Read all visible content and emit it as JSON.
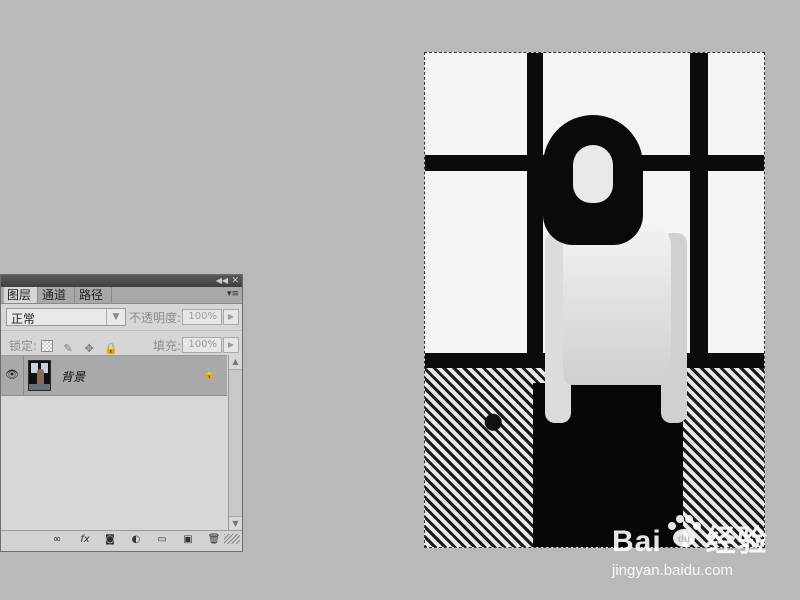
{
  "layers_panel": {
    "tabs": [
      {
        "label": "图层",
        "active": true
      },
      {
        "label": "通道",
        "active": false
      },
      {
        "label": "路径",
        "active": false
      }
    ],
    "blend_mode": "正常",
    "opacity_label": "不透明度:",
    "opacity_value": "100%",
    "lock_label": "锁定:",
    "fill_label": "填充:",
    "fill_value": "100%",
    "layers": [
      {
        "name": "背景",
        "visible": true,
        "locked": true
      }
    ],
    "bottom_icons": [
      "link-icon",
      "fx-icon",
      "mask-icon",
      "adjustment-icon",
      "folder-icon",
      "new-layer-icon",
      "trash-icon"
    ]
  },
  "watermark": {
    "logo_text": "Bai",
    "logo_suffix": "经验",
    "url": "jingyan.baidu.com"
  },
  "colors": {
    "workspace": "#b9b9b9",
    "panel": "#d6d6d6",
    "selected_layer": "#a9a9a9"
  }
}
